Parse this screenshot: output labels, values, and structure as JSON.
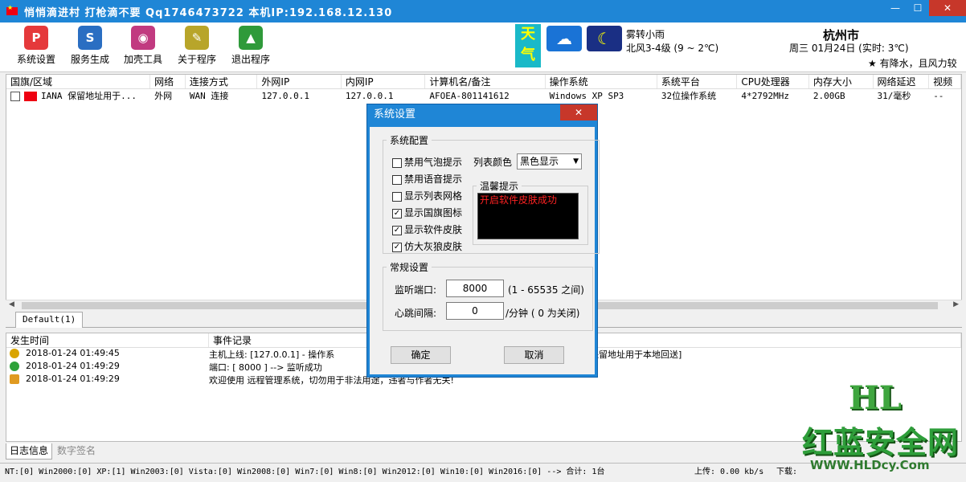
{
  "window": {
    "title": "悄悄滴进村 打枪滴不要 Qq1746473722 本机IP:192.168.12.130",
    "min": "—",
    "max": "☐",
    "close": "✕"
  },
  "toolbar": {
    "items": [
      {
        "label": "系统设置",
        "icon": "settings-icon",
        "color": "#e5393b",
        "glyph": "P"
      },
      {
        "label": "服务生成",
        "icon": "service-icon",
        "color": "#2a6ec2",
        "glyph": "S"
      },
      {
        "label": "加壳工具",
        "icon": "pack-icon",
        "color": "#c13a80",
        "glyph": "◉"
      },
      {
        "label": "关于程序",
        "icon": "about-icon",
        "color": "#b8a52a",
        "glyph": "✎"
      },
      {
        "label": "退出程序",
        "icon": "exit-icon",
        "color": "#2f9a3a",
        "glyph": "▲"
      }
    ]
  },
  "weather": {
    "badge": "天气",
    "condition": "雾转小雨",
    "wind_temp": "北风3-4级 (9 ~ 2℃)",
    "city": "杭州市",
    "date": "周三 01月24日 (实时: 3℃)",
    "scroll_note": "★ 有降水，且风力较"
  },
  "list": {
    "columns": [
      "国旗/区域",
      "网络",
      "连接方式",
      "外网IP",
      "内网IP",
      "计算机名/备注",
      "操作系统",
      "系统平台",
      "CPU处理器",
      "内存大小",
      "网络延迟",
      "视频"
    ],
    "rows": [
      {
        "region": "IANA 保留地址用于...",
        "net": "外网",
        "conn": "WAN 连接",
        "wan_ip": "127.0.0.1",
        "lan_ip": "127.0.0.1",
        "host": "AFOEA-801141612",
        "os": "Windows XP SP3",
        "platform": "32位操作系统",
        "cpu": "4*2792MHz",
        "mem": "2.00GB",
        "latency": "31/毫秒",
        "video": "--"
      }
    ]
  },
  "tab": {
    "default": "Default(1)"
  },
  "log": {
    "columns": [
      "发生时间",
      "事件记录"
    ],
    "rows": [
      {
        "time": "2018-01-24 01:49:45",
        "event": "主机上线: [127.0.0.1]  -  操作系",
        "tail": "保留地址用于本地回送]",
        "icon": "user-online-icon",
        "color": "#d9a400"
      },
      {
        "time": "2018-01-24 01:49:29",
        "event": "端口: [ 8000 ]  --> 监听成功",
        "icon": "check-icon",
        "color": "#2ea23a"
      },
      {
        "time": "2018-01-24 01:49:29",
        "event": "欢迎使用 远程管理系统，切勿用于非法用途，违者与作者无关!",
        "icon": "home-icon",
        "color": "#e09a20"
      }
    ]
  },
  "bottom_tabs": {
    "log": "日志信息",
    "sign": "数字签名"
  },
  "status": {
    "os_counts": "NT:[0] Win2000:[0] XP:[1] Win2003:[0] Vista:[0] Win2008:[0] Win7:[0] Win8:[0] Win2012:[0] Win10:[0] Win2016:[0] --> 合计: 1台",
    "upload": "上传: 0.00 kb/s",
    "download": "下载:"
  },
  "watermark": {
    "hl": "HL",
    "cn": "红蓝安全网",
    "url": "WWW.HLDcy.Com"
  },
  "dialog": {
    "title": "系统设置",
    "close": "✕",
    "config_legend": "系统配置",
    "checkboxes": [
      {
        "label": "禁用气泡提示",
        "checked": false
      },
      {
        "label": "禁用语音提示",
        "checked": false
      },
      {
        "label": "显示列表网格",
        "checked": false
      },
      {
        "label": "显示国旗图标",
        "checked": true
      },
      {
        "label": "显示软件皮肤",
        "checked": true
      },
      {
        "label": "仿大灰狼皮肤",
        "checked": true
      }
    ],
    "list_color_label": "列表颜色",
    "list_color_value": "黑色显示",
    "tip_legend": "温馨提示",
    "tip_text": "开启软件皮肤成功",
    "general_legend": "常规设置",
    "port_label": "监听端口:",
    "port_value": "8000",
    "port_hint": "(1 - 65535 之间)",
    "heartbeat_label": "心跳间隔:",
    "heartbeat_value": "0",
    "heartbeat_hint": "/分钟 ( 0 为关闭)",
    "ok": "确定",
    "cancel": "取消"
  }
}
